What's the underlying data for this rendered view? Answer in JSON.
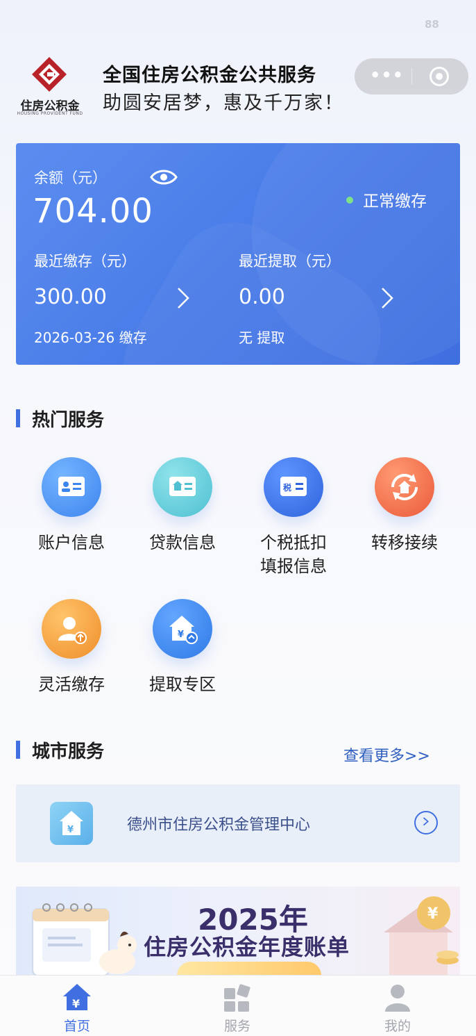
{
  "status_bar": {
    "signal_number": "88"
  },
  "header": {
    "logo_text": "住房公积金",
    "logo_subtext": "HOUSING PROVIDENT FUND",
    "title": "全国住房公积金公共服务",
    "subtitle": "助圆安居梦，惠及千万家！",
    "menu_icon": "more-dots-icon",
    "close_icon": "miniprogram-close-icon"
  },
  "balance_card": {
    "balance_label": "余额（元）",
    "balance_value": "704.00",
    "visibility_icon": "eye-icon",
    "status_text": "正常缴存",
    "status_color": "#7ee28a",
    "recent_deposit_label": "最近缴存（元）",
    "recent_deposit_value": "300.00",
    "recent_deposit_note": "2026-03-26 缴存",
    "recent_withdraw_label": "最近提取（元）",
    "recent_withdraw_value": "0.00",
    "recent_withdraw_note": "无 提取",
    "accent": "#4a7ce8"
  },
  "hot_services": {
    "title": "热门服务",
    "items": [
      {
        "label": "账户信息",
        "icon": "account-card-icon",
        "color": "#4a8ff0"
      },
      {
        "label": "贷款信息",
        "icon": "loan-house-card-icon",
        "color": "#5cc8d8"
      },
      {
        "label": "个税抵扣",
        "label2": "填报信息",
        "icon": "tax-card-icon",
        "color": "#3f75e6"
      },
      {
        "label": "转移接续",
        "icon": "transfer-house-icon",
        "color": "#f07048"
      },
      {
        "label": "灵活缴存",
        "icon": "flexible-deposit-user-icon",
        "color": "#f4a03a"
      },
      {
        "label": "提取专区",
        "icon": "withdraw-house-icon",
        "color": "#3c8be8"
      }
    ]
  },
  "city_services": {
    "title": "城市服务",
    "more_link": "查看更多>>",
    "center_name": "德州市住房公积金管理中心",
    "center_icon": "yuan-house-icon"
  },
  "banner": {
    "year": "2025年",
    "title": "住房公积金年度账单"
  },
  "tabbar": {
    "items": [
      {
        "label": "首页",
        "icon": "home-yuan-icon",
        "active": true
      },
      {
        "label": "服务",
        "icon": "grid-services-icon",
        "active": false
      },
      {
        "label": "我的",
        "icon": "user-icon",
        "active": false
      }
    ],
    "active_color": "#3f6fe0",
    "inactive_color": "#a3a6ad"
  }
}
